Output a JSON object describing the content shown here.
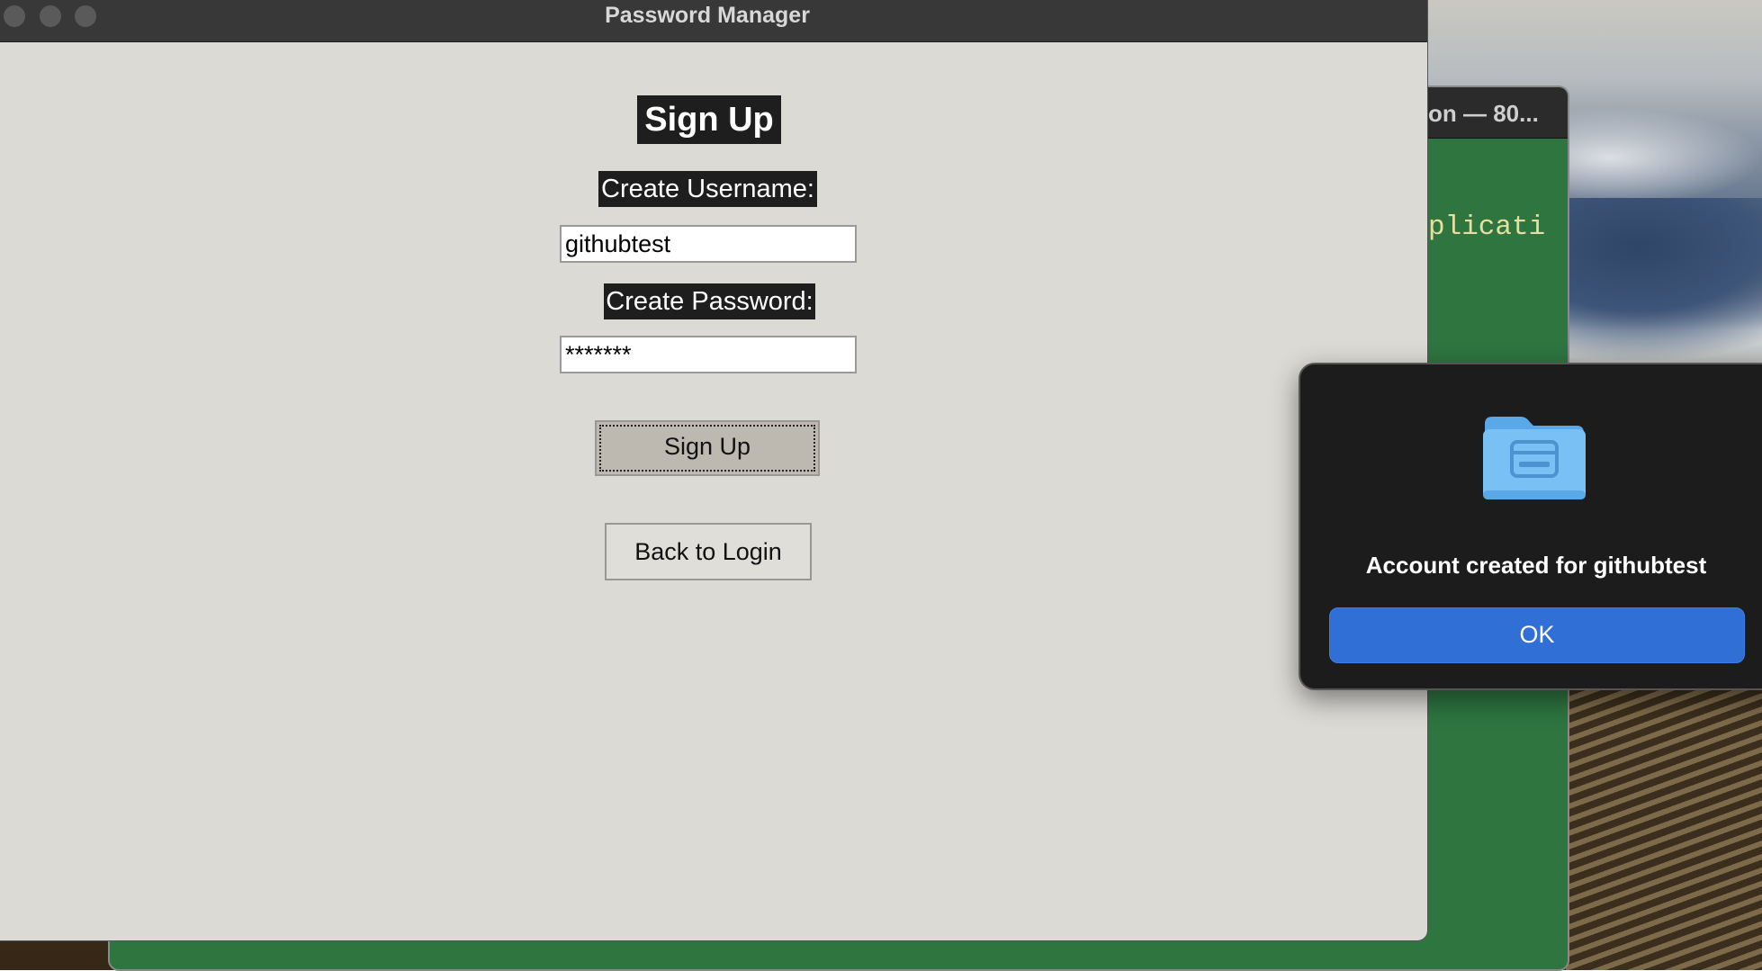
{
  "app": {
    "window_title": "Password Manager",
    "heading": "Sign Up",
    "username_label": "Create Username:",
    "username_value": "githubtest",
    "password_label": "Create Password:",
    "password_value": "*******",
    "signup_button": "Sign Up",
    "back_button": "Back to Login"
  },
  "terminal": {
    "title_fragment": "on — 80...",
    "text_fragment": "plicati"
  },
  "alert": {
    "icon": "folder-icon",
    "message": "Account created for githubtest",
    "ok_button": "OK"
  },
  "colors": {
    "dialog_accent": "#2f6fd6",
    "window_bg": "#dcdad5",
    "label_bg": "#1e1e1e",
    "terminal_bg": "#2e7540"
  }
}
